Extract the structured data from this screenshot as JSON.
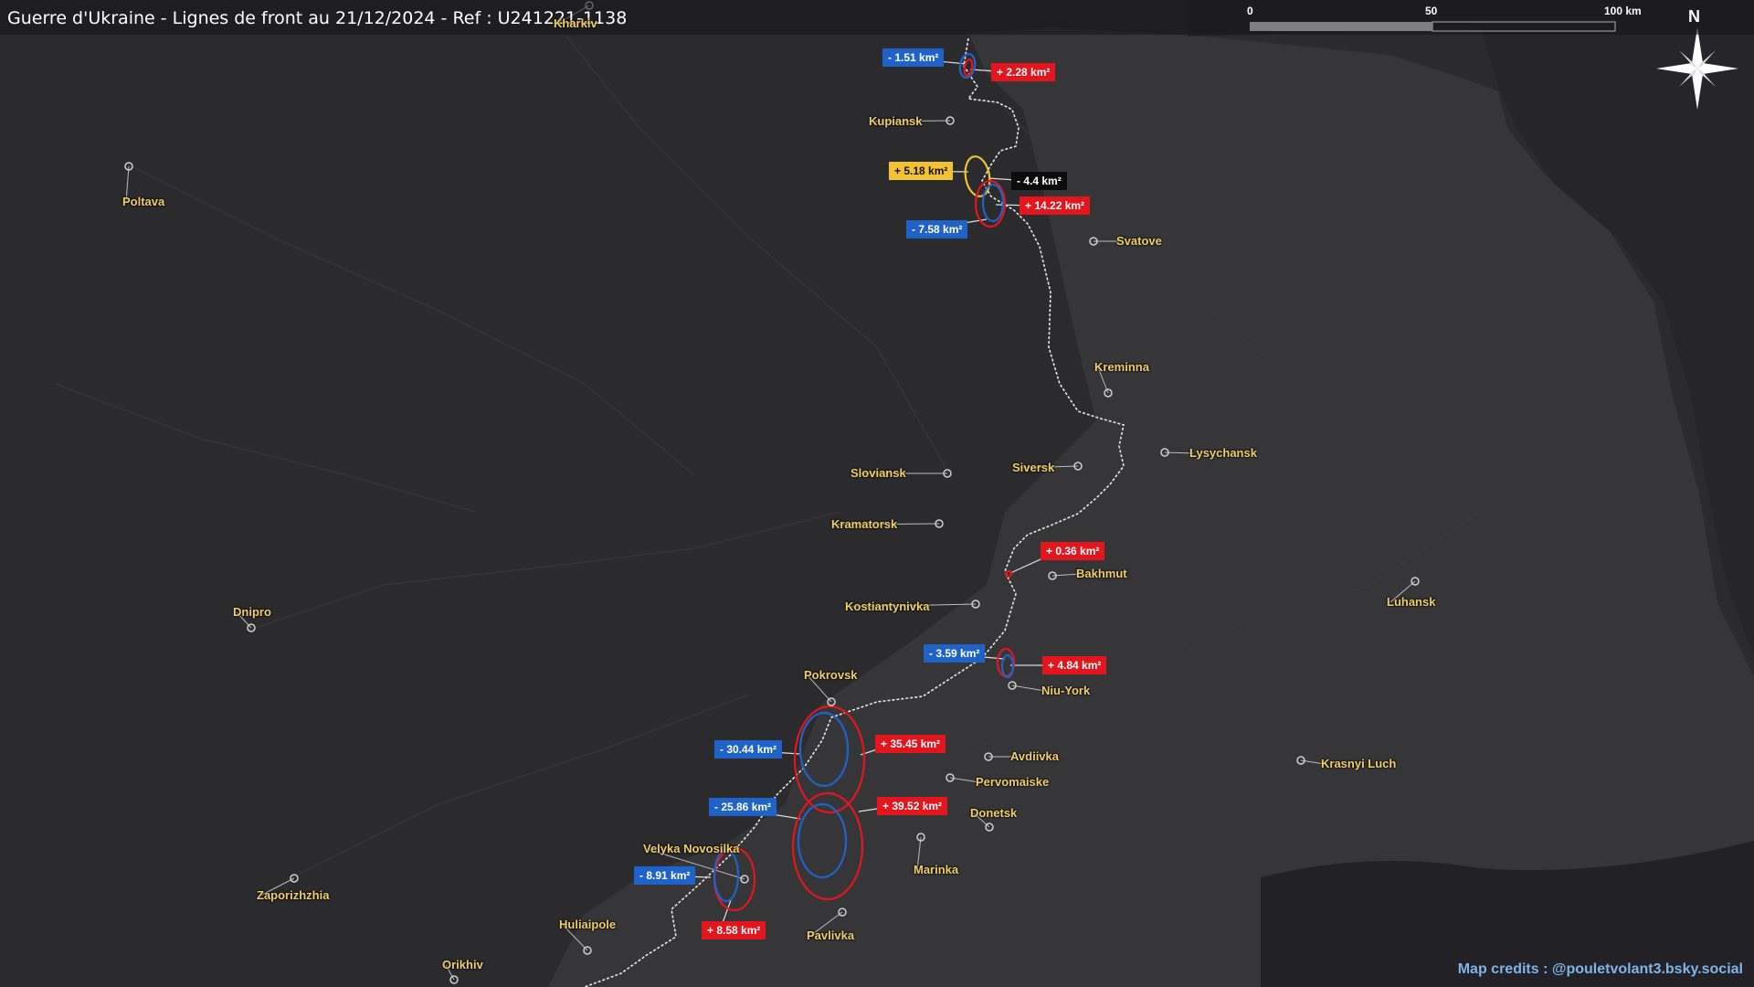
{
  "title": "Guerre d'Ukraine - Lignes de front au 21/12/2024 - Ref : U241221-1138",
  "credits": "Map credits : @pouletvolant3.bsky.social",
  "scale": {
    "l0": "0",
    "l50": "50",
    "l100": "100 km"
  },
  "north_label": "N",
  "colors": {
    "gain_ru": "#e3151d",
    "gain_ua": "#1f63c9",
    "contested": "#f2c230",
    "city_label": "#f3cf6a",
    "front_line": "#ffffff"
  },
  "cities": [
    {
      "name": "Kharkiv"
    },
    {
      "name": "Kupiansk"
    },
    {
      "name": "Poltava"
    },
    {
      "name": "Svatove"
    },
    {
      "name": "Kreminna"
    },
    {
      "name": "Lysychansk"
    },
    {
      "name": "Siversk"
    },
    {
      "name": "Sloviansk"
    },
    {
      "name": "Kramatorsk"
    },
    {
      "name": "Bakhmut"
    },
    {
      "name": "Kostiantynivka"
    },
    {
      "name": "Luhansk"
    },
    {
      "name": "Dnipro"
    },
    {
      "name": "Pokrovsk"
    },
    {
      "name": "Niu-York"
    },
    {
      "name": "Avdiivka"
    },
    {
      "name": "Pervomaiske"
    },
    {
      "name": "Krasnyi Luch"
    },
    {
      "name": "Donetsk"
    },
    {
      "name": "Marinka"
    },
    {
      "name": "Velyka Novosilka"
    },
    {
      "name": "Zaporizhzhia"
    },
    {
      "name": "Huliaipole"
    },
    {
      "name": "Pavlivka"
    },
    {
      "name": "Orikhiv"
    }
  ],
  "changes": [
    {
      "label": "- 1.51 km²",
      "type": "blue"
    },
    {
      "label": "+ 2.28 km²",
      "type": "red"
    },
    {
      "label": "+ 5.18 km²",
      "type": "yellow"
    },
    {
      "label": "- 4.4 km²",
      "type": "black"
    },
    {
      "label": "+ 14.22 km²",
      "type": "red"
    },
    {
      "label": "- 7.58 km²",
      "type": "blue"
    },
    {
      "label": "+ 0.36 km²",
      "type": "red"
    },
    {
      "label": "- 3.59 km²",
      "type": "blue"
    },
    {
      "label": "+ 4.84 km²",
      "type": "red"
    },
    {
      "label": "- 30.44 km²",
      "type": "blue"
    },
    {
      "label": "+ 35.45 km²",
      "type": "red"
    },
    {
      "label": "- 25.86 km²",
      "type": "blue"
    },
    {
      "label": "+ 39.52 km²",
      "type": "red"
    },
    {
      "label": "- 8.91 km²",
      "type": "blue"
    },
    {
      "label": "+ 8.58 km²",
      "type": "red"
    }
  ]
}
